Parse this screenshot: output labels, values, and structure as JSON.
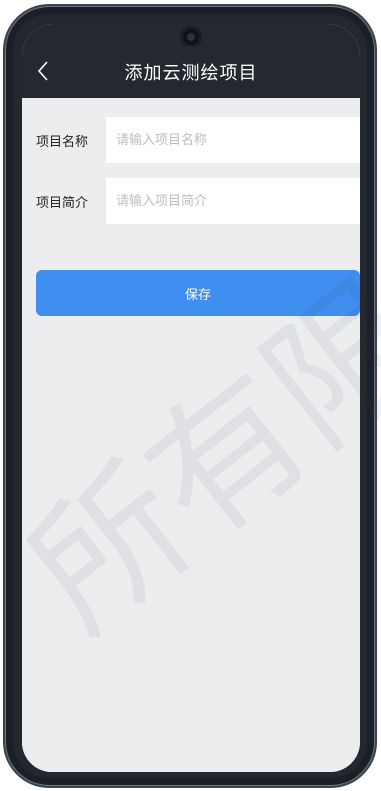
{
  "header": {
    "title": "添加云测绘项目"
  },
  "form": {
    "fields": [
      {
        "label": "项目名称",
        "placeholder": "请输入项目名称",
        "value": ""
      },
      {
        "label": "项目简介",
        "placeholder": "请输入项目简介",
        "value": ""
      }
    ],
    "save_label": "保存"
  },
  "watermark": {
    "text": "所有限公"
  },
  "colors": {
    "navbar": "#24292f",
    "background": "#ecedef",
    "accent": "#3f8ef0"
  },
  "icons": {
    "back": "chevron-left-icon"
  }
}
